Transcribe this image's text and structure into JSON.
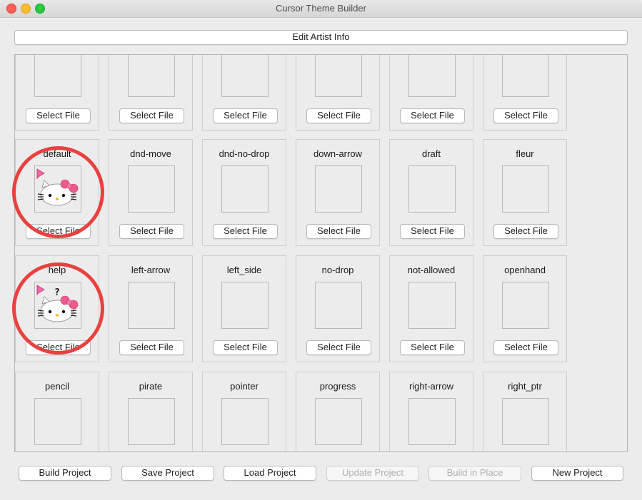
{
  "window": {
    "title": "Cursor Theme Builder"
  },
  "artist_button": "Edit Artist Info",
  "select_file_label": "Select File",
  "rows": [
    {
      "cells": [
        {
          "label": ""
        },
        {
          "label": ""
        },
        {
          "label": ""
        },
        {
          "label": ""
        },
        {
          "label": ""
        },
        {
          "label": ""
        }
      ]
    },
    {
      "cells": [
        {
          "label": "default",
          "has_image": true
        },
        {
          "label": "dnd-move"
        },
        {
          "label": "dnd-no-drop"
        },
        {
          "label": "down-arrow"
        },
        {
          "label": "draft"
        },
        {
          "label": "fleur"
        }
      ]
    },
    {
      "cells": [
        {
          "label": "help",
          "has_image": true
        },
        {
          "label": "left-arrow"
        },
        {
          "label": "left_side"
        },
        {
          "label": "no-drop"
        },
        {
          "label": "not-allowed"
        },
        {
          "label": "openhand"
        }
      ]
    },
    {
      "cells": [
        {
          "label": "pencil"
        },
        {
          "label": "pirate"
        },
        {
          "label": "pointer"
        },
        {
          "label": "progress"
        },
        {
          "label": "right-arrow"
        },
        {
          "label": "right_ptr"
        }
      ]
    }
  ],
  "footer": {
    "build_project": "Build Project",
    "save_project": "Save Project",
    "load_project": "Load Project",
    "update_project": "Update Project",
    "build_in_place": "Build in Place",
    "new_project": "New Project"
  },
  "colors": {
    "annotation_circle": "#e8413f",
    "flag": "#ee6aa7",
    "bow": "#f05a8f"
  },
  "help_glyph": "?"
}
